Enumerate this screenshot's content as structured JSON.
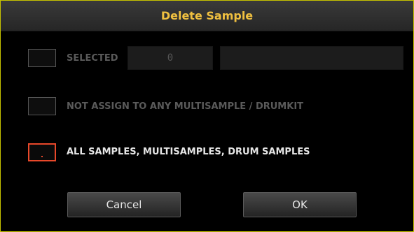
{
  "dialog": {
    "title": "Delete Sample",
    "options": [
      {
        "label": "SELECTED",
        "checked": false,
        "enabled": false
      },
      {
        "label": "NOT ASSIGN TO ANY MULTISAMPLE / DRUMKIT",
        "checked": false,
        "enabled": false
      },
      {
        "label": "ALL SAMPLES, MULTISAMPLES, DRUM SAMPLES",
        "checked": true,
        "enabled": true
      }
    ],
    "selected_count": "0",
    "selected_name": "",
    "buttons": {
      "cancel": "Cancel",
      "ok": "OK"
    }
  },
  "colors": {
    "title": "#f0c040",
    "frame": "#c8c400",
    "checkbox_active": "#e8482a",
    "disabled_text": "#5a5a5a"
  }
}
